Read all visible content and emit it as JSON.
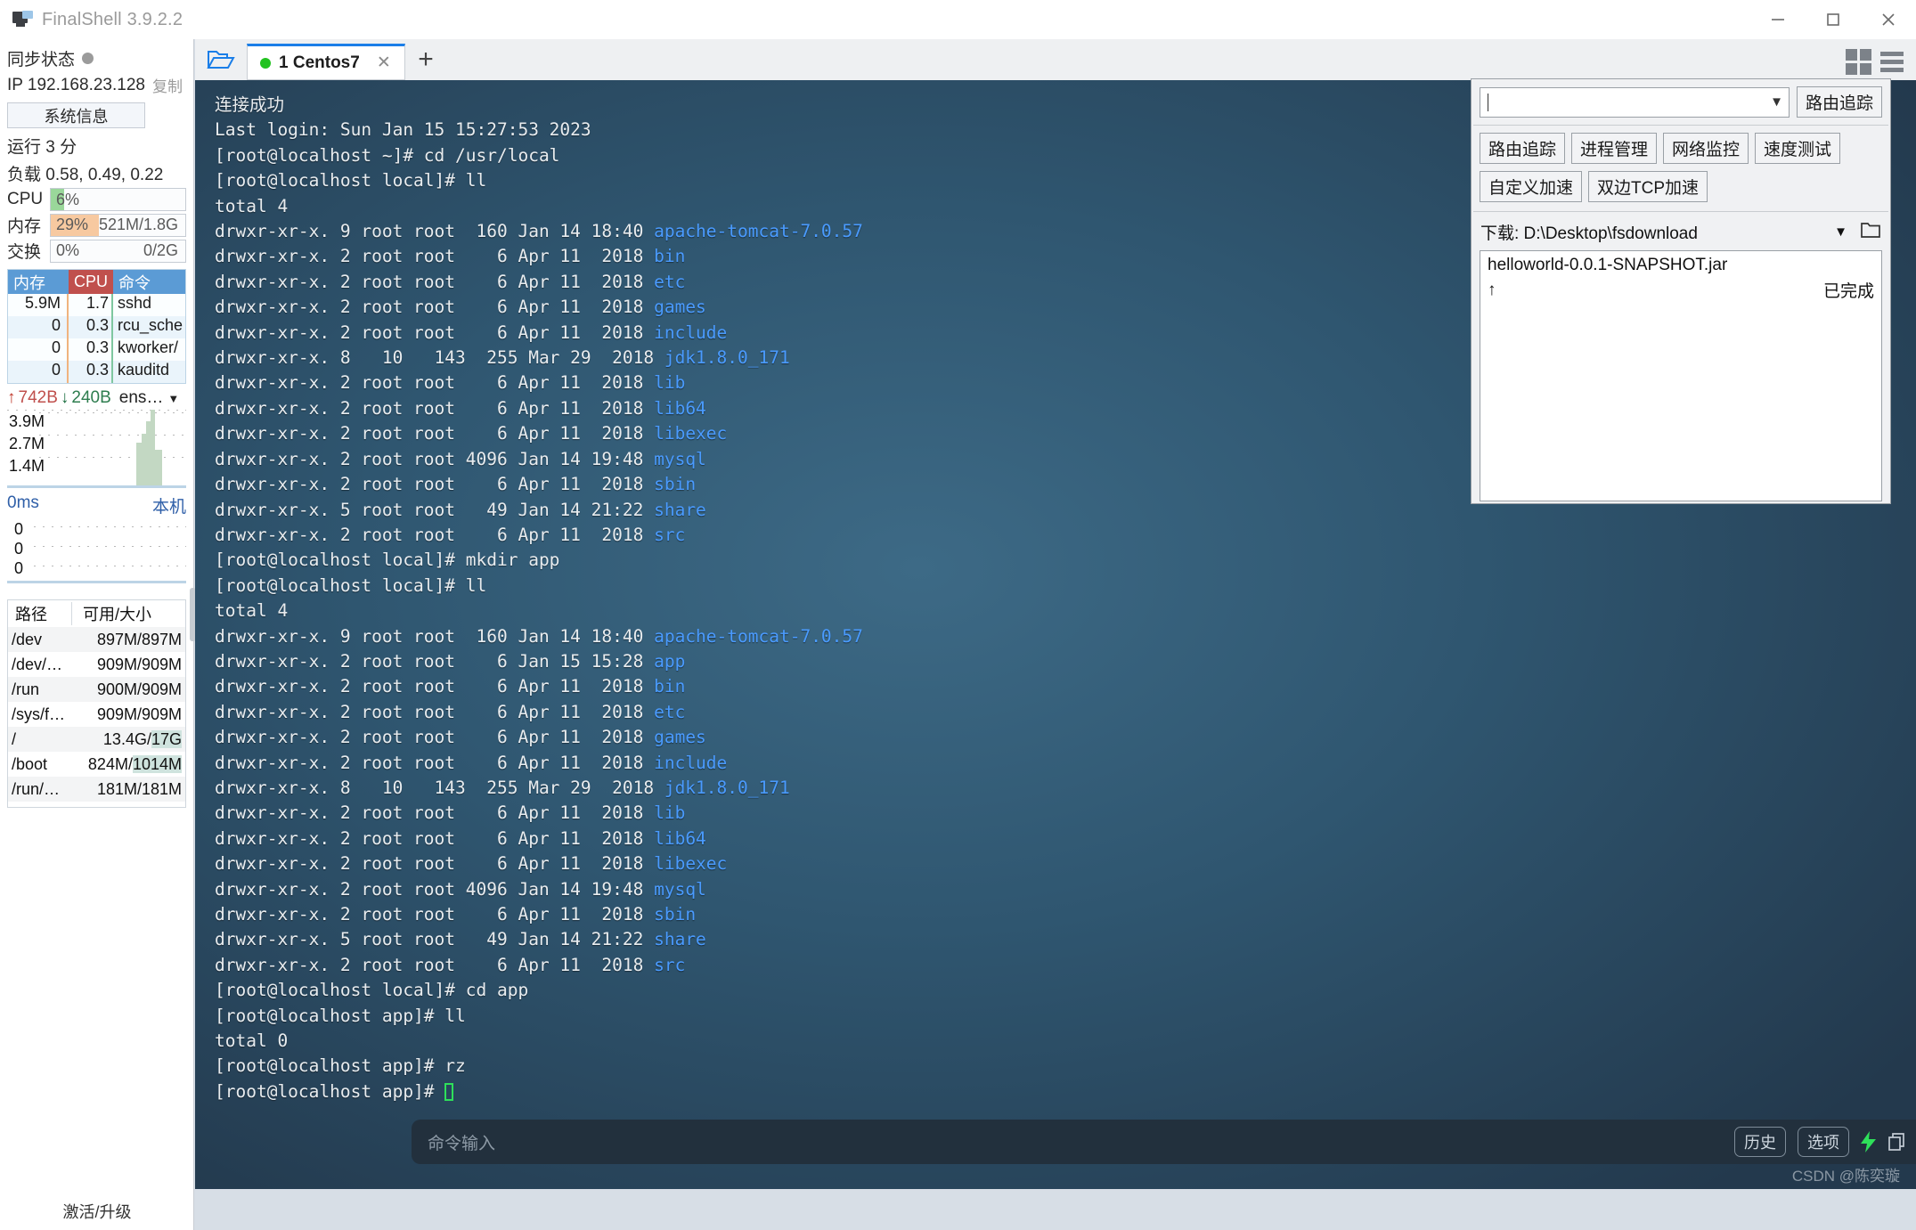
{
  "window": {
    "app_title": "FinalShell 3.9.2.2",
    "minimize": "—",
    "maximize": "□",
    "close": "✕"
  },
  "sidebar": {
    "sync_label": "同步状态",
    "ip_label": "IP 192.168.23.128",
    "copy_label": "复制",
    "sysinfo_button": "系统信息",
    "uptime": "运行 3 分",
    "load": "负载 0.58, 0.49, 0.22",
    "meters": [
      {
        "name": "CPU",
        "percent": "6%",
        "detail": "",
        "fill_color": "#9ad79a",
        "fill_width": "10%"
      },
      {
        "name": "内存",
        "percent": "29%",
        "detail": "521M/1.8G",
        "fill_color": "#f7c9a0",
        "fill_width": "29%"
      },
      {
        "name": "交换",
        "percent": "0%",
        "detail": "0/2G",
        "fill_color": "#f7c9a0",
        "fill_width": "0%"
      }
    ],
    "process_table": {
      "headers": [
        "内存",
        "CPU",
        "命令"
      ],
      "rows": [
        {
          "mem": "5.9M",
          "cpu": "1.7",
          "cmd": "sshd"
        },
        {
          "mem": "0",
          "cpu": "0.3",
          "cmd": "rcu_sche"
        },
        {
          "mem": "0",
          "cpu": "0.3",
          "cmd": "kworker/"
        },
        {
          "mem": "0",
          "cpu": "0.3",
          "cmd": "kauditd"
        }
      ]
    },
    "network": {
      "up_value": "742B",
      "down_value": "240B",
      "interface": "ens…",
      "y_labels": [
        "3.9M",
        "2.7M",
        "1.4M"
      ]
    },
    "ping": {
      "latency": "0ms",
      "host_label": "本机",
      "y_labels": [
        "0",
        "0",
        "0"
      ]
    },
    "disk_table": {
      "headers": [
        "路径",
        "可用/大小"
      ],
      "rows": [
        {
          "path": "/dev",
          "size": "897M/897M",
          "highlight": ""
        },
        {
          "path": "/dev/…",
          "size": "909M/909M",
          "highlight": ""
        },
        {
          "path": "/run",
          "size": "900M/909M",
          "highlight": ""
        },
        {
          "path": "/sys/f…",
          "size": "909M/909M",
          "highlight": ""
        },
        {
          "path": "/",
          "size": "13.4G/17G",
          "highlight": "17G"
        },
        {
          "path": "/boot",
          "size": "824M/1014M",
          "highlight": "1014M"
        },
        {
          "path": "/run/…",
          "size": "181M/181M",
          "highlight": ""
        }
      ]
    },
    "activate_label": "激活/升级"
  },
  "tabbar": {
    "folder_icon": "open-folder-icon",
    "tab_label": "1 Centos7",
    "tab_close": "✕",
    "new_tab": "+"
  },
  "terminal": {
    "lines": [
      {
        "text": "连接成功",
        "dir": ""
      },
      {
        "text": "Last login: Sun Jan 15 15:27:53 2023",
        "dir": ""
      },
      {
        "text": "[root@localhost ~]# cd /usr/local",
        "dir": ""
      },
      {
        "text": "[root@localhost local]# ll",
        "dir": ""
      },
      {
        "text": "total 4",
        "dir": ""
      },
      {
        "text": "drwxr-xr-x. 9 root root  160 Jan 14 18:40 ",
        "dir": "apache-tomcat-7.0.57"
      },
      {
        "text": "drwxr-xr-x. 2 root root    6 Apr 11  2018 ",
        "dir": "bin"
      },
      {
        "text": "drwxr-xr-x. 2 root root    6 Apr 11  2018 ",
        "dir": "etc"
      },
      {
        "text": "drwxr-xr-x. 2 root root    6 Apr 11  2018 ",
        "dir": "games"
      },
      {
        "text": "drwxr-xr-x. 2 root root    6 Apr 11  2018 ",
        "dir": "include"
      },
      {
        "text": "drwxr-xr-x. 8   10   143  255 Mar 29  2018 ",
        "dir": "jdk1.8.0_171"
      },
      {
        "text": "drwxr-xr-x. 2 root root    6 Apr 11  2018 ",
        "dir": "lib"
      },
      {
        "text": "drwxr-xr-x. 2 root root    6 Apr 11  2018 ",
        "dir": "lib64"
      },
      {
        "text": "drwxr-xr-x. 2 root root    6 Apr 11  2018 ",
        "dir": "libexec"
      },
      {
        "text": "drwxr-xr-x. 2 root root 4096 Jan 14 19:48 ",
        "dir": "mysql"
      },
      {
        "text": "drwxr-xr-x. 2 root root    6 Apr 11  2018 ",
        "dir": "sbin"
      },
      {
        "text": "drwxr-xr-x. 5 root root   49 Jan 14 21:22 ",
        "dir": "share"
      },
      {
        "text": "drwxr-xr-x. 2 root root    6 Apr 11  2018 ",
        "dir": "src"
      },
      {
        "text": "[root@localhost local]# mkdir app",
        "dir": ""
      },
      {
        "text": "[root@localhost local]# ll",
        "dir": ""
      },
      {
        "text": "total 4",
        "dir": ""
      },
      {
        "text": "drwxr-xr-x. 9 root root  160 Jan 14 18:40 ",
        "dir": "apache-tomcat-7.0.57"
      },
      {
        "text": "drwxr-xr-x. 2 root root    6 Jan 15 15:28 ",
        "dir": "app"
      },
      {
        "text": "drwxr-xr-x. 2 root root    6 Apr 11  2018 ",
        "dir": "bin"
      },
      {
        "text": "drwxr-xr-x. 2 root root    6 Apr 11  2018 ",
        "dir": "etc"
      },
      {
        "text": "drwxr-xr-x. 2 root root    6 Apr 11  2018 ",
        "dir": "games"
      },
      {
        "text": "drwxr-xr-x. 2 root root    6 Apr 11  2018 ",
        "dir": "include"
      },
      {
        "text": "drwxr-xr-x. 8   10   143  255 Mar 29  2018 ",
        "dir": "jdk1.8.0_171"
      },
      {
        "text": "drwxr-xr-x. 2 root root    6 Apr 11  2018 ",
        "dir": "lib"
      },
      {
        "text": "drwxr-xr-x. 2 root root    6 Apr 11  2018 ",
        "dir": "lib64"
      },
      {
        "text": "drwxr-xr-x. 2 root root    6 Apr 11  2018 ",
        "dir": "libexec"
      },
      {
        "text": "drwxr-xr-x. 2 root root 4096 Jan 14 19:48 ",
        "dir": "mysql"
      },
      {
        "text": "drwxr-xr-x. 2 root root    6 Apr 11  2018 ",
        "dir": "sbin"
      },
      {
        "text": "drwxr-xr-x. 5 root root   49 Jan 14 21:22 ",
        "dir": "share"
      },
      {
        "text": "drwxr-xr-x. 2 root root    6 Apr 11  2018 ",
        "dir": "src"
      },
      {
        "text": "[root@localhost local]# cd app",
        "dir": ""
      },
      {
        "text": "[root@localhost app]# ll",
        "dir": ""
      },
      {
        "text": "total 0",
        "dir": ""
      },
      {
        "text": "[root@localhost app]# rz",
        "dir": ""
      }
    ],
    "prompt": "[root@localhost app]# "
  },
  "command_bar": {
    "placeholder": "命令输入",
    "history_button": "历史",
    "options_button": "选项",
    "icons": [
      "bolt-icon",
      "copy-icon",
      "paste-icon",
      "search-icon",
      "gear-icon",
      "upload-icon",
      "window-icon"
    ]
  },
  "right_panel": {
    "combo_value": "",
    "trace_button": "路由追踪",
    "tool_buttons": [
      "路由追踪",
      "进程管理",
      "网络监控",
      "速度测试"
    ],
    "accel_buttons": [
      "自定义加速",
      "双边TCP加速"
    ],
    "download_label": "下载: D:\\Desktop\\fsdownload",
    "files": [
      {
        "name": "helloworld-0.0.1-SNAPSHOT.jar",
        "status": "已完成"
      }
    ]
  },
  "watermark": "CSDN @陈奕璇"
}
